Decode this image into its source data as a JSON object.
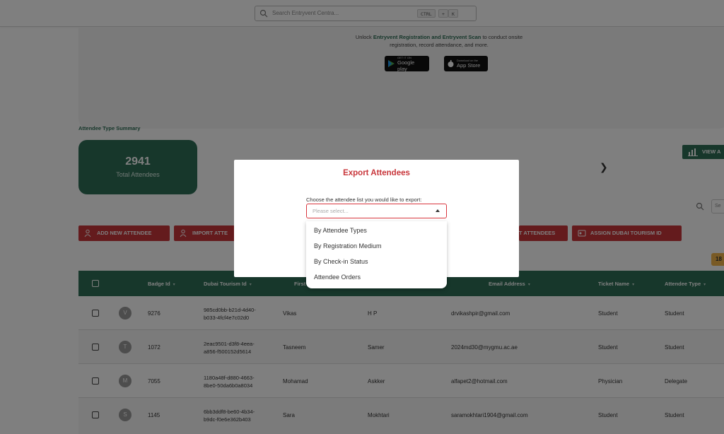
{
  "search": {
    "placeholder": "Search Entryvent Centra...",
    "keys": [
      "CTRL",
      "+",
      "K"
    ]
  },
  "promo": {
    "text_pre": "Unlock ",
    "text_bold": "Entryvent Registration and Entryvent Scan",
    "text_post": " to conduct onsite registration, record attendance, and more.",
    "google_small": "GET IT ON",
    "google_label": "Google play",
    "apple_small": "Download on the",
    "apple_label": "App Store"
  },
  "summary": {
    "title": "Attendee Type Summary",
    "total_value": "2941",
    "total_label": "Total Attendees",
    "view_all_label": "VIEW A"
  },
  "toolbar": {
    "search_placeholder": "Se",
    "buttons": [
      {
        "label": "ADD NEW ATTENDEE"
      },
      {
        "label": "IMPORT ATTE"
      },
      {
        "label": "T ATTENDEES"
      },
      {
        "label": "ASSIGN DUBAI TOURISM ID"
      }
    ],
    "count_badge": "18"
  },
  "table": {
    "columns": [
      "Badge Id",
      "Dubai Tourism Id",
      "First",
      "Email Address",
      "Ticket Name",
      "Attendee Type"
    ],
    "rows": [
      {
        "initial": "V",
        "badge": "9276",
        "dt_line1": "985cd0bb-b21d-4d40-",
        "dt_line2": "b033-4fcf4e7c02d0",
        "first": "Vikas",
        "last": "H P",
        "email": "drvikashpir@gmail.com",
        "ticket": "Student",
        "type": "Student"
      },
      {
        "initial": "T",
        "badge": "1072",
        "dt_line1": "2eac9501-d3f8-4eea-",
        "dt_line2": "a856-f500152d5614",
        "first": "Tasneem",
        "last": "Samer",
        "email": "2024md30@mygmu.ac.ae",
        "ticket": "Student",
        "type": "Student"
      },
      {
        "initial": "M",
        "badge": "7055",
        "dt_line1": "1180a48f-d880-4663-",
        "dt_line2": "8be0-50da6b0a8034",
        "first": "Mohamad",
        "last": "Askker",
        "email": "alfapet2@hotmail.com",
        "ticket": "Physician",
        "type": "Delegate"
      },
      {
        "initial": "S",
        "badge": "1145",
        "dt_line1": "6bb3ddf8-be60-4b34-",
        "dt_line2": "b9dc-f0e6e362b403",
        "first": "Sara",
        "last": "Mokhtari",
        "email": "saramokhtari1904@gmail.com",
        "ticket": "Student",
        "type": "Student"
      }
    ]
  },
  "modal": {
    "title": "Export Attendees",
    "prompt": "Choose the attendee list you would like to export:",
    "select_placeholder": "Please select...",
    "options": [
      "By Attendee Types",
      "By Registration Medium",
      "By Check-in Status",
      "Attendee Orders"
    ]
  },
  "colors": {
    "brand_green": "#2e6f57",
    "accent_red": "#c8363b",
    "badge_yellow": "#f3b54a"
  }
}
